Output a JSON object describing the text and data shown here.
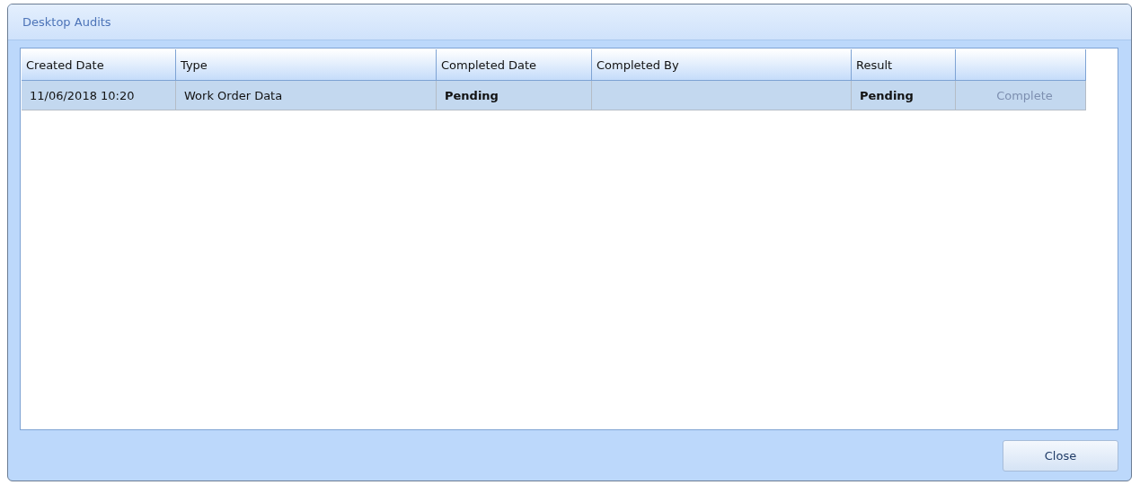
{
  "window": {
    "title": "Desktop Audits"
  },
  "table": {
    "columns": [
      "Created Date",
      "Type",
      "Completed Date",
      "Completed By",
      "Result",
      ""
    ],
    "rows": [
      {
        "selected": true,
        "cells": [
          {
            "kind": "text",
            "text": "11/06/2018 10:20"
          },
          {
            "kind": "text",
            "text": "Work Order Data"
          },
          {
            "kind": "bold",
            "text": "Pending"
          },
          {
            "kind": "text",
            "text": ""
          },
          {
            "kind": "bold",
            "text": "Pending"
          },
          {
            "kind": "link",
            "text": "Complete"
          }
        ]
      }
    ]
  },
  "buttons": [
    {
      "label": "Close"
    }
  ]
}
